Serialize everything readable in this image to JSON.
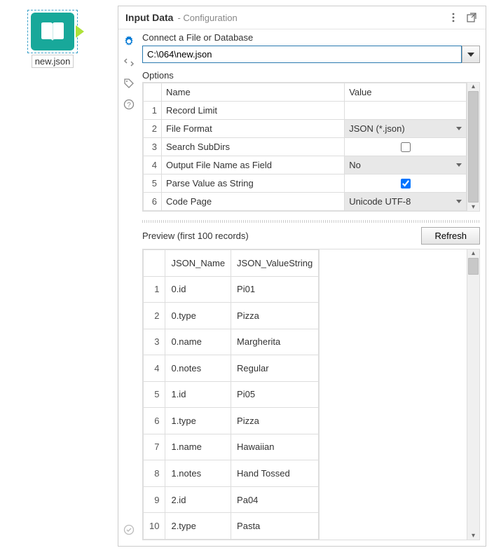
{
  "node": {
    "label": "new.json"
  },
  "panel": {
    "title": "Input Data",
    "subtitle": "- Configuration"
  },
  "connect": {
    "label": "Connect a File or Database",
    "path": "C:\\064\\new.json"
  },
  "options": {
    "section_label": "Options",
    "headers": {
      "name": "Name",
      "value": "Value"
    },
    "rows": [
      {
        "num": "1",
        "name": "Record Limit",
        "type": "blank",
        "value": ""
      },
      {
        "num": "2",
        "name": "File Format",
        "type": "select",
        "value": "JSON (*.json)"
      },
      {
        "num": "3",
        "name": "Search SubDirs",
        "type": "check",
        "checked": false
      },
      {
        "num": "4",
        "name": "Output File Name as Field",
        "type": "select",
        "value": "No"
      },
      {
        "num": "5",
        "name": "Parse Value as String",
        "type": "check",
        "checked": true
      },
      {
        "num": "6",
        "name": "Code Page",
        "type": "select",
        "value": "Unicode UTF-8"
      }
    ]
  },
  "preview": {
    "label": "Preview (first 100 records)",
    "refresh": "Refresh",
    "headers": {
      "col1": "JSON_Name",
      "col2": "JSON_ValueString"
    },
    "rows": [
      {
        "num": "1",
        "c1": "0.id",
        "c2": "Pi01"
      },
      {
        "num": "2",
        "c1": "0.type",
        "c2": "Pizza"
      },
      {
        "num": "3",
        "c1": "0.name",
        "c2": "Margherita"
      },
      {
        "num": "4",
        "c1": "0.notes",
        "c2": "Regular"
      },
      {
        "num": "5",
        "c1": "1.id",
        "c2": "Pi05"
      },
      {
        "num": "6",
        "c1": "1.type",
        "c2": "Pizza"
      },
      {
        "num": "7",
        "c1": "1.name",
        "c2": "Hawaiian"
      },
      {
        "num": "8",
        "c1": "1.notes",
        "c2": "Hand Tossed"
      },
      {
        "num": "9",
        "c1": "2.id",
        "c2": "Pa04"
      },
      {
        "num": "10",
        "c1": "2.type",
        "c2": "Pasta"
      }
    ]
  }
}
